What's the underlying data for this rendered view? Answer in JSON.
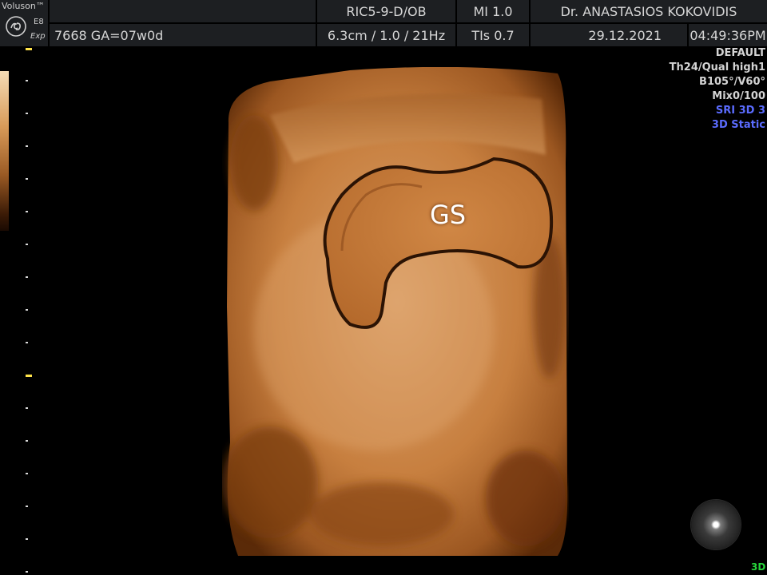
{
  "header": {
    "brand": "Voluson™",
    "model": "E8",
    "edition": "Exp",
    "probe": "RIC5-9-D/OB",
    "mi": "MI  1.0",
    "operator": "Dr. ANASTASIOS KOKOVIDIS",
    "patient": "7668  GA=07w0d",
    "depth_freq": "6.3cm / 1.0 / 21Hz",
    "tis": "TIs  0.7",
    "date": "29.12.2021",
    "time": "04:49:36PM"
  },
  "image": {
    "annotation": "GS"
  },
  "settings": {
    "preset": "DEFAULT",
    "quality": "Th24/Qual high1",
    "angles": "B105°/V60°",
    "mix": "Mix0/100",
    "sri": "SRI 3D 3",
    "mode": "3D Static"
  },
  "status": {
    "mode_indicator": "3D"
  },
  "colors": {
    "header_bg": "#1d1f22",
    "tissue": "#c87e40",
    "info_blue": "#5b6cff",
    "mode_green": "#26d43a"
  }
}
